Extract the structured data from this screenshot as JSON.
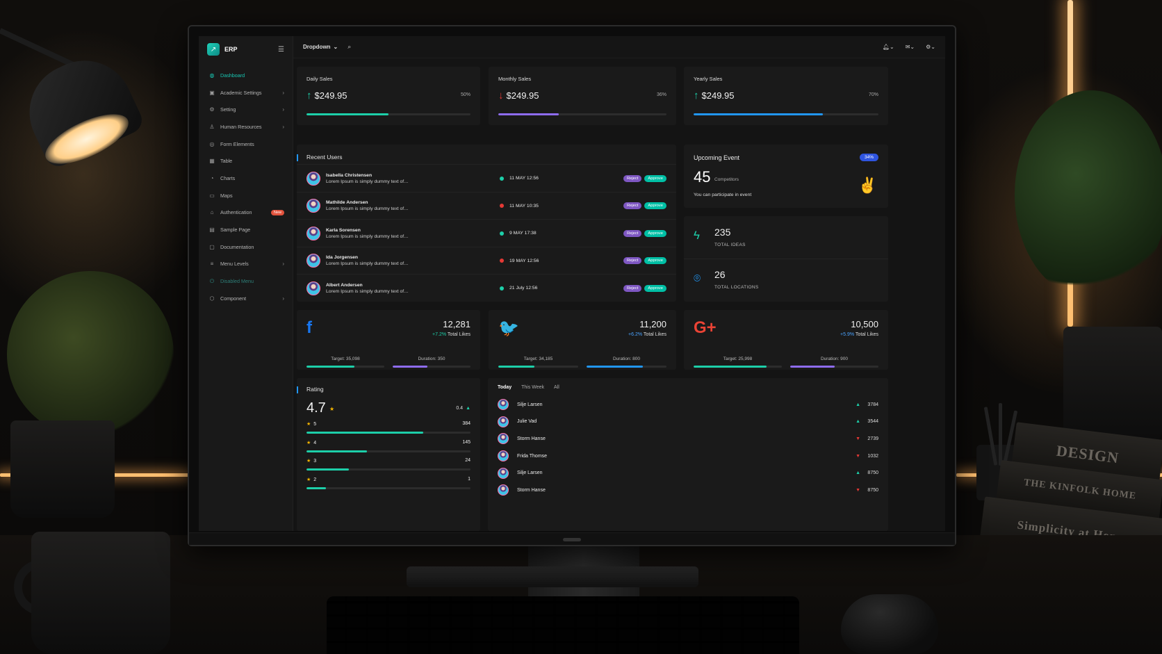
{
  "app": {
    "name": "ERP"
  },
  "topbar": {
    "dropdown_label": "Dropdown"
  },
  "sidebar": {
    "items": [
      {
        "label": "Dashboard",
        "icon": "dashboard-icon",
        "active": true,
        "has_children": false
      },
      {
        "label": "Academic Settings",
        "icon": "academic-icon",
        "has_children": true
      },
      {
        "label": "Setting",
        "icon": "gear-icon",
        "has_children": true
      },
      {
        "label": "Human Resources",
        "icon": "user-icon",
        "has_children": true
      },
      {
        "label": "Form Elements",
        "icon": "form-icon",
        "has_children": false
      },
      {
        "label": "Table",
        "icon": "table-icon",
        "has_children": false
      },
      {
        "label": "Charts",
        "icon": "chart-icon",
        "has_children": false
      },
      {
        "label": "Maps",
        "icon": "map-icon",
        "has_children": false
      },
      {
        "label": "Authentication",
        "icon": "lock-icon",
        "badge": "New",
        "has_children": false
      },
      {
        "label": "Sample Page",
        "icon": "page-icon",
        "has_children": false
      },
      {
        "label": "Documentation",
        "icon": "doc-icon",
        "has_children": false
      },
      {
        "label": "Menu Levels",
        "icon": "menu-icon",
        "has_children": true
      },
      {
        "label": "Disabled Menu",
        "icon": "power-icon",
        "disabled": true,
        "has_children": false
      },
      {
        "label": "Component",
        "icon": "component-icon",
        "has_children": true
      }
    ]
  },
  "sales": [
    {
      "title": "Daily Sales",
      "value": "$249.95",
      "trend": "up",
      "percent": "50%",
      "progress": 0.5,
      "color": "#1dcfa9"
    },
    {
      "title": "Monthly Sales",
      "value": "$249.95",
      "trend": "down",
      "percent": "36%",
      "progress": 0.36,
      "color": "#8e6cf0"
    },
    {
      "title": "Yearly Sales",
      "value": "$249.95",
      "trend": "up",
      "percent": "70%",
      "progress": 0.7,
      "color": "#2196f3"
    }
  ],
  "recent_users": {
    "title": "Recent Users",
    "reject_label": "Reject",
    "approve_label": "Approve",
    "rows": [
      {
        "name": "Isabella Christensen",
        "desc": "Lorem Ipsum is simply dummy text of…",
        "date": "11 MAY 12:56",
        "status_color": "#1dcfa9"
      },
      {
        "name": "Mathilde Andersen",
        "desc": "Lorem Ipsum is simply dummy text of…",
        "date": "11 MAY 10:35",
        "status_color": "#e53935"
      },
      {
        "name": "Karla Sorensen",
        "desc": "Lorem Ipsum is simply dummy text of…",
        "date": "9 MAY 17:38",
        "status_color": "#1dcfa9"
      },
      {
        "name": "Ida Jorgensen",
        "desc": "Lorem Ipsum is simply dummy text of…",
        "date": "19 MAY 12:56",
        "status_color": "#e53935"
      },
      {
        "name": "Albert Andersen",
        "desc": "Lorem Ipsum is simply dummy text of…",
        "date": "21 July 12:56",
        "status_color": "#1dcfa9"
      }
    ]
  },
  "upcoming_event": {
    "title": "Upcoming Event",
    "badge": "34%",
    "count": "45",
    "count_label": "Competitors",
    "note": "You can participate in event"
  },
  "stats": [
    {
      "value": "235",
      "label": "TOTAL IDEAS",
      "icon": "lightning-icon",
      "color": "#1dcfa9"
    },
    {
      "value": "26",
      "label": "TOTAL LOCATIONS",
      "icon": "location-pin-icon",
      "color": "#2196f3"
    }
  ],
  "social": [
    {
      "network": "facebook",
      "icon_char": "f",
      "icon_color": "#1877f2",
      "total": "12,281",
      "delta": "+7.2%",
      "delta_class": "g",
      "delta_label": "Total Likes",
      "target_label": "Target: 35,098",
      "duration_label": "Duration: 350",
      "target_progress": 0.62,
      "duration_progress": 0.45,
      "target_color": "#1dcfa9",
      "duration_color": "#8e6cf0"
    },
    {
      "network": "twitter",
      "icon_char": "🐦",
      "icon_color": "#1da1f2",
      "total": "11,200",
      "delta": "+6.2%",
      "delta_class": "b",
      "delta_label": "Total Likes",
      "target_label": "Target: 34,185",
      "duration_label": "Duration: 800",
      "target_progress": 0.45,
      "duration_progress": 0.7,
      "target_color": "#1dcfa9",
      "duration_color": "#2196f3"
    },
    {
      "network": "google-plus",
      "icon_char": "G+",
      "icon_color": "#ea4335",
      "total": "10,500",
      "delta": "+5.9%",
      "delta_class": "b",
      "delta_label": "Total Likes",
      "target_label": "Target: 25,998",
      "duration_label": "Duration: 900",
      "target_progress": 0.83,
      "duration_progress": 0.5,
      "target_color": "#1dcfa9",
      "duration_color": "#8e6cf0"
    }
  ],
  "rating": {
    "title": "Rating",
    "value": "4.7",
    "delta": "0.4",
    "rows": [
      {
        "stars": "5",
        "count": "384",
        "progress": 0.71
      },
      {
        "stars": "4",
        "count": "145",
        "progress": 0.37
      },
      {
        "stars": "3",
        "count": "24",
        "progress": 0.26
      },
      {
        "stars": "2",
        "count": "1",
        "progress": 0.12
      }
    ]
  },
  "leaderboard": {
    "tabs": [
      "Today",
      "This Week",
      "All"
    ],
    "active_tab": 0,
    "rows": [
      {
        "name": "Silje Larsen",
        "trend": "up",
        "value": "3784"
      },
      {
        "name": "Julie Vad",
        "trend": "up",
        "value": "3544"
      },
      {
        "name": "Storm Hanse",
        "trend": "down",
        "value": "2739"
      },
      {
        "name": "Frida Thomse",
        "trend": "down",
        "value": "1032"
      },
      {
        "name": "Silje Larsen",
        "trend": "up",
        "value": "8750"
      },
      {
        "name": "Storm Hanse",
        "trend": "down",
        "value": "8750"
      }
    ]
  },
  "scene": {
    "books": [
      "DESIGN",
      "THE KINFOLK HOME",
      "Simplicity at Home"
    ]
  }
}
